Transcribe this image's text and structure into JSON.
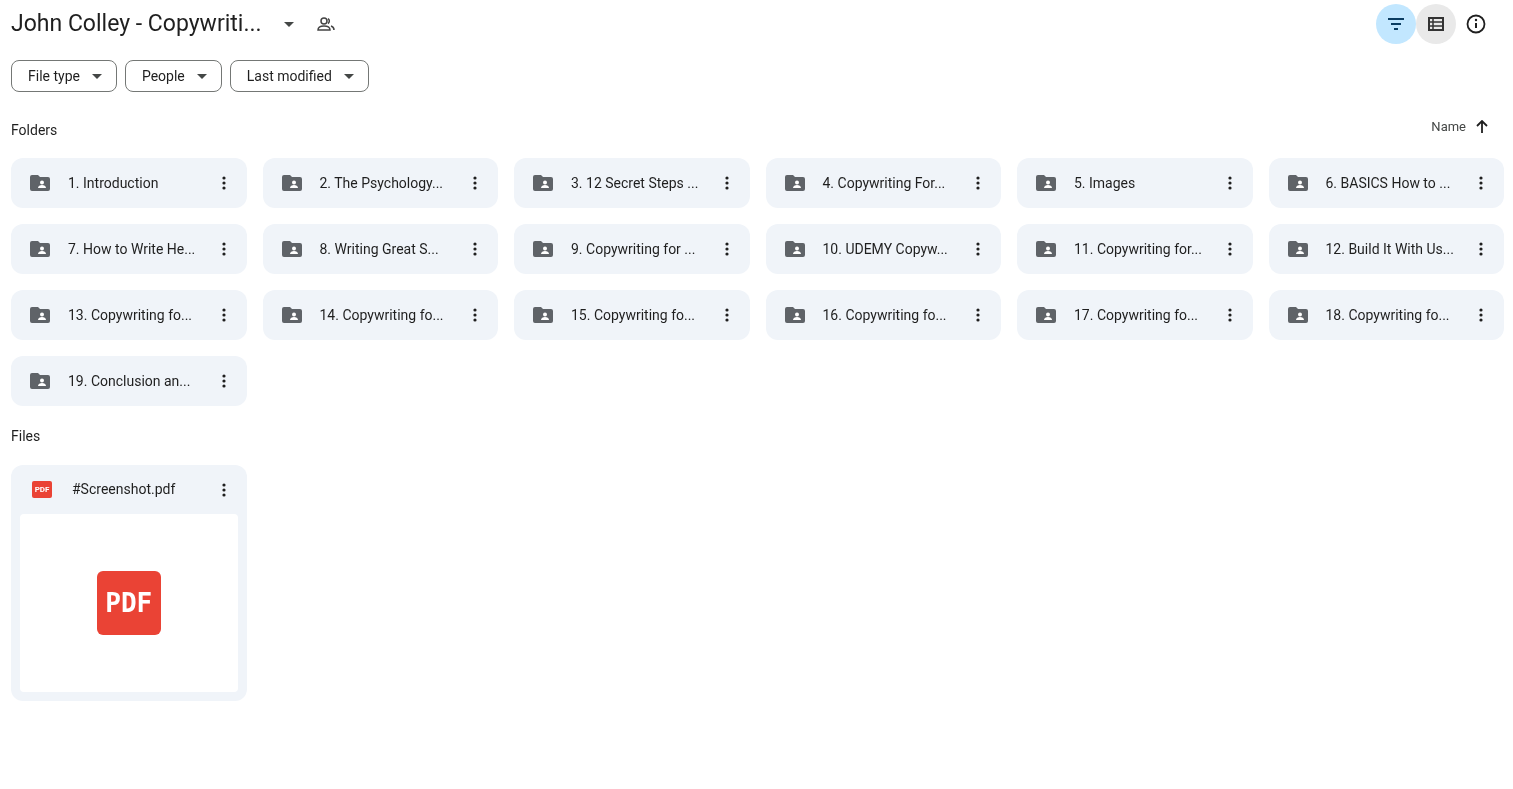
{
  "header": {
    "title": "John Colley - Copywriti...",
    "toolbar": [
      {
        "kind": "filter",
        "selected": true,
        "hovered": false
      },
      {
        "kind": "list",
        "selected": false,
        "hovered": true
      },
      {
        "kind": "info",
        "selected": false,
        "hovered": false
      }
    ]
  },
  "filters": [
    "File type",
    "People",
    "Last modified"
  ],
  "folders": {
    "heading": "Folders",
    "sort": "Name",
    "items": [
      "1. Introduction",
      "2. The Psychology...",
      "3. 12 Secret Steps ...",
      "4. Copywriting For...",
      "5. Images",
      "6. BASICS How to ...",
      "7. How to Write He...",
      "8. Writing Great S...",
      "9. Copywriting for ...",
      "10. UDEMY Copyw...",
      "11. Copywriting for...",
      "12. Build It With Us...",
      "13. Copywriting fo...",
      "14. Copywriting fo...",
      "15. Copywriting fo...",
      "16. Copywriting fo...",
      "17. Copywriting fo...",
      "18. Copywriting fo...",
      "19. Conclusion an..."
    ]
  },
  "files": {
    "heading": "Files",
    "items": [
      {
        "name": "#Screenshot.pdf",
        "icon_label": "PDF",
        "preview_label": "PDF"
      }
    ]
  }
}
